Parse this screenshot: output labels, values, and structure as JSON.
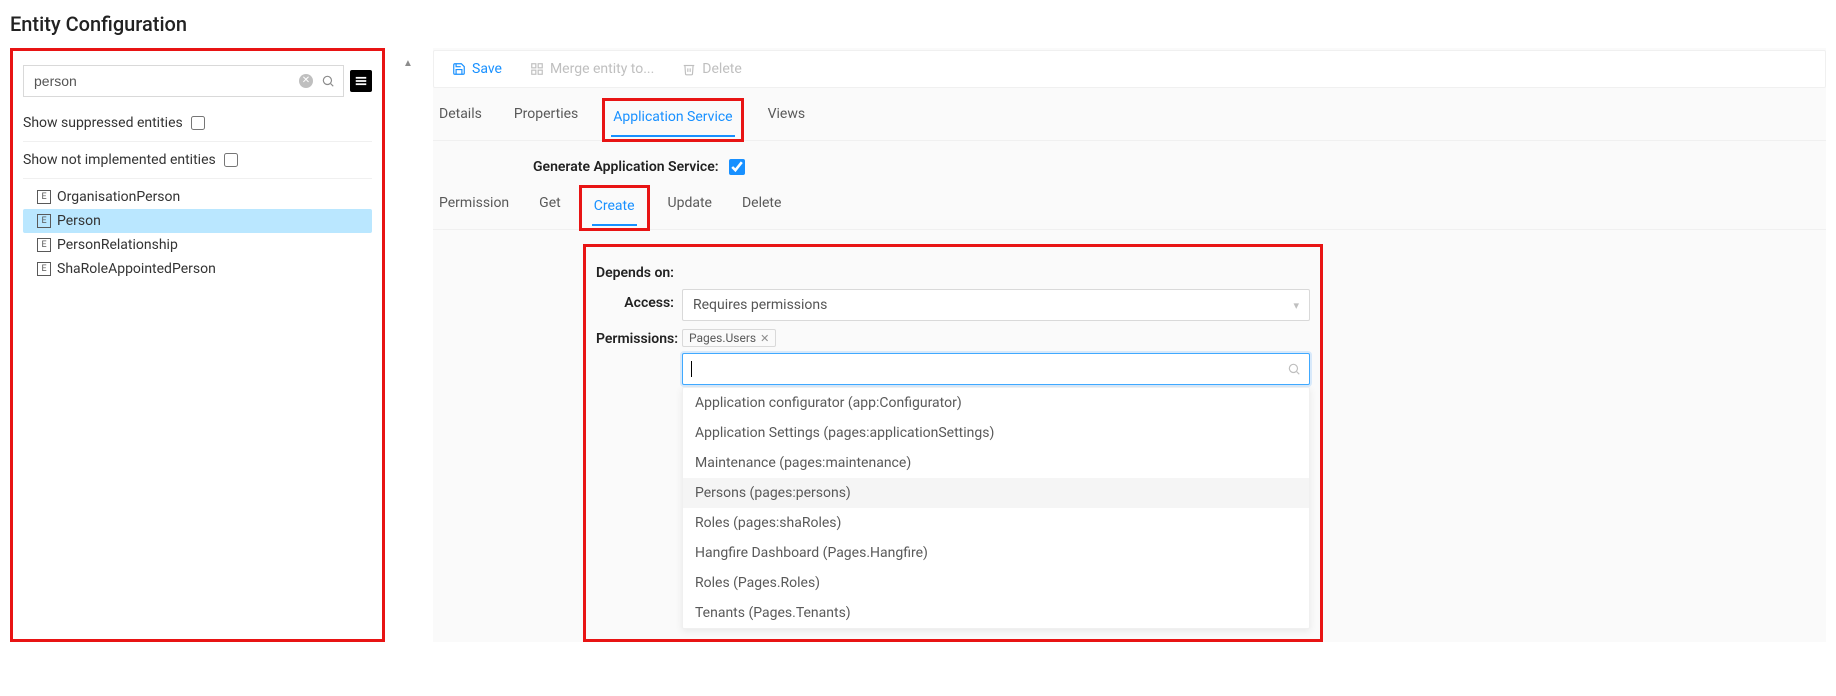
{
  "page_title": "Entity Configuration",
  "left": {
    "search_value": "person",
    "show_suppressed_label": "Show suppressed entities",
    "show_suppressed_checked": false,
    "show_notimpl_label": "Show not implemented entities",
    "show_notimpl_checked": false,
    "entities": [
      {
        "label": "OrganisationPerson",
        "selected": false
      },
      {
        "label": "Person",
        "selected": true
      },
      {
        "label": "PersonRelationship",
        "selected": false
      },
      {
        "label": "ShaRoleAppointedPerson",
        "selected": false
      }
    ]
  },
  "toolbar": {
    "save": "Save",
    "merge": "Merge entity to...",
    "delete": "Delete"
  },
  "main_tabs": {
    "details": "Details",
    "properties": "Properties",
    "app_service": "Application Service",
    "views": "Views",
    "active": "app_service"
  },
  "gen_label": "Generate Application Service:",
  "gen_checked": true,
  "sub_tabs": {
    "permission": "Permission",
    "get": "Get",
    "create": "Create",
    "update": "Update",
    "delete": "Delete",
    "active": "create"
  },
  "section": {
    "depends_on_label": "Depends on:",
    "access_label": "Access:",
    "access_value": "Requires permissions",
    "permissions_label": "Permissions:",
    "permission_tags": [
      "Pages.Users"
    ],
    "dropdown_items": [
      {
        "label": "Application configurator (app:Configurator)",
        "hover": false
      },
      {
        "label": "Application Settings (pages:applicationSettings)",
        "hover": false
      },
      {
        "label": "Maintenance (pages:maintenance)",
        "hover": false
      },
      {
        "label": "Persons (pages:persons)",
        "hover": true
      },
      {
        "label": "Roles (pages:shaRoles)",
        "hover": false
      },
      {
        "label": "Hangfire Dashboard (Pages.Hangfire)",
        "hover": false
      },
      {
        "label": "Roles (Pages.Roles)",
        "hover": false
      },
      {
        "label": "Tenants (Pages.Tenants)",
        "hover": false
      }
    ]
  }
}
